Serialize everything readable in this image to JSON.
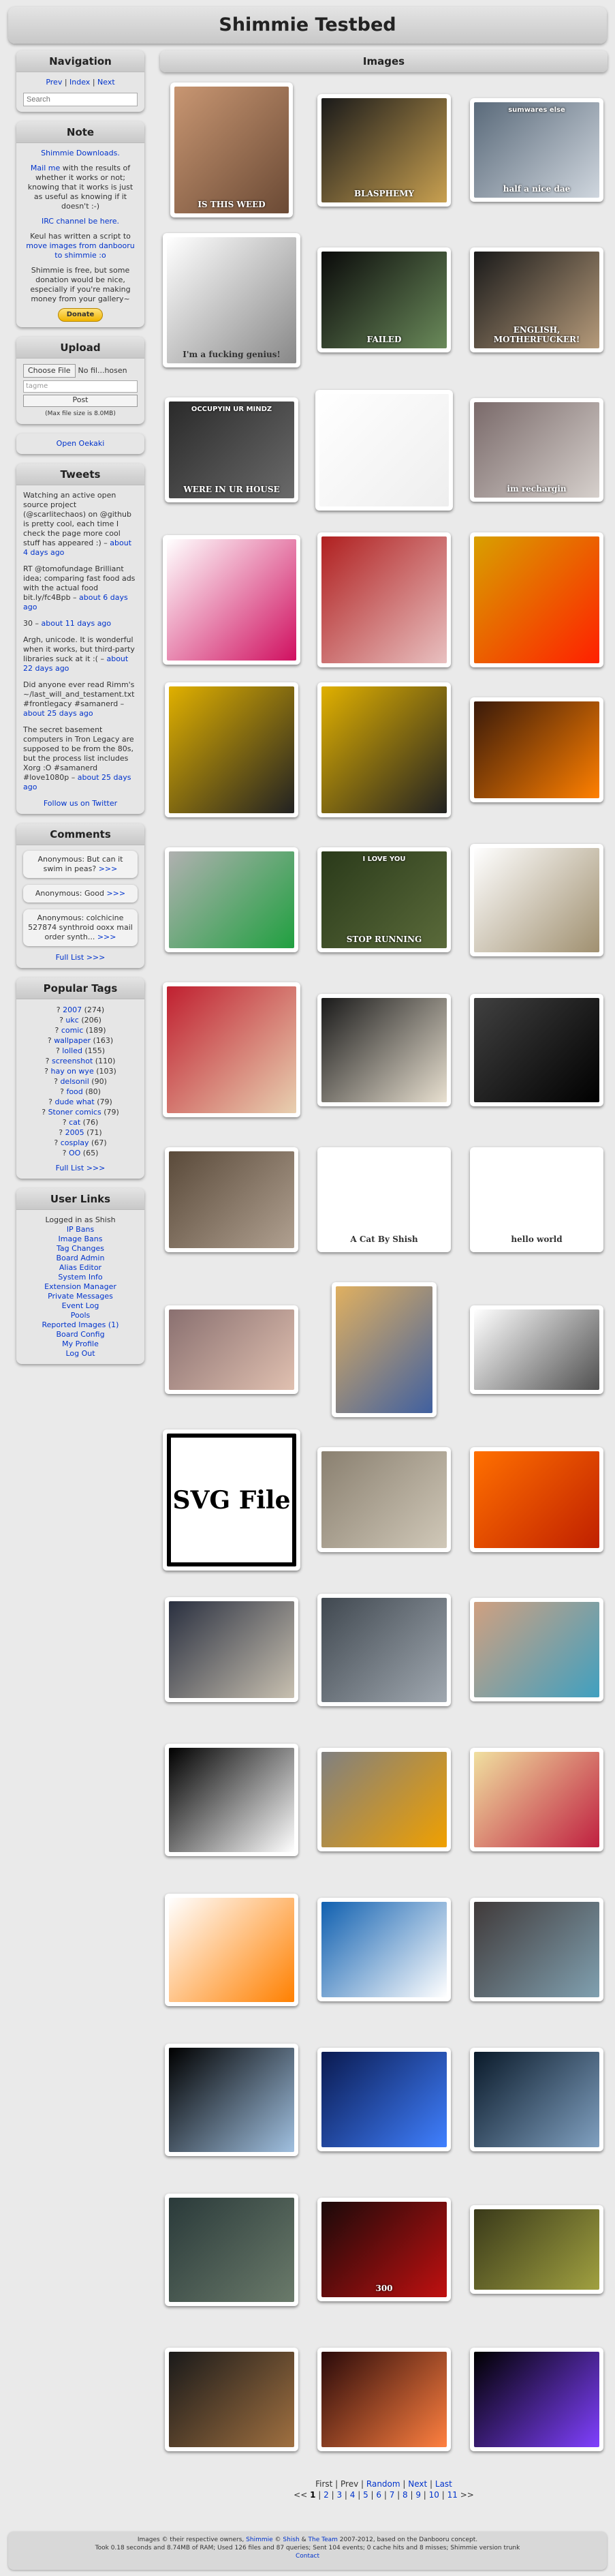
{
  "site_title": "Shimmie Testbed",
  "nav": {
    "title": "Navigation",
    "prev": "Prev",
    "index": "Index",
    "next": "Next",
    "search_placeholder": "Search"
  },
  "note": {
    "title": "Note",
    "link_downloads": "Shimmie Downloads.",
    "mail_link": "Mail me",
    "mail_text": " with the results of whether it works or not; knowing that it works is just as useful as knowing if it doesn't :-)",
    "irc": "IRC channel be here.",
    "keul_text": "Keul has written a script to",
    "keul_link": "move images from danbooru to shimmie :o",
    "free_text": "Shimmie is free, but some donation would be nice, especially if you're making money from your gallery~",
    "donate": "Donate"
  },
  "upload": {
    "title": "Upload",
    "choose": "Choose File",
    "no_file": "No fil...hosen",
    "tags_placeholder": "tagme",
    "post": "Post",
    "max_size": "(Max file size is 8.0MB)"
  },
  "open_oekaki": "Open Oekaki",
  "tweets": {
    "title": "Tweets",
    "items": [
      {
        "text": "Watching an active open source project (@scarlitechaos) on @github is pretty cool, each time I check the page more cool stuff has appeared :) –",
        "time": "about 4 days ago"
      },
      {
        "text": "RT @tomofundage Brilliant idea; comparing fast food ads with the actual food bit.ly/fc4Bpb –",
        "time": "about 6 days ago"
      },
      {
        "text": "30 –",
        "time": "about 11 days ago"
      },
      {
        "text": "Argh, unicode. It is wonderful when it works, but third-party libraries suck at it :( –",
        "time": "about 22 days ago"
      },
      {
        "text": "Did anyone ever read Rimm's ~/last_will_and_testament.txt #frontlegacy #samanerd –",
        "time": "about 25 days ago"
      },
      {
        "text": "The secret basement computers in Tron Legacy are supposed to be from the 80s, but the process list includes Xorg :O #samanerd #love1080p –",
        "time": "about 25 days ago"
      }
    ],
    "follow": "Follow us on Twitter"
  },
  "comments": {
    "title": "Comments",
    "items": [
      {
        "text": "Anonymous: But can it swim in peas?",
        "more": ">>>"
      },
      {
        "text": "Anonymous: Good",
        "more": ">>>"
      },
      {
        "text": "Anonymous: colchicine 527874 synthroid ooxx mail order synth...",
        "more": ">>>"
      }
    ],
    "full_list": "Full List >>>"
  },
  "popular_tags": {
    "title": "Popular Tags",
    "items": [
      {
        "name": "2007",
        "count": "(274)"
      },
      {
        "name": "ukc",
        "count": "(206)"
      },
      {
        "name": "comic",
        "count": "(189)"
      },
      {
        "name": "wallpaper",
        "count": "(163)"
      },
      {
        "name": "lolled",
        "count": "(155)"
      },
      {
        "name": "screenshot",
        "count": "(110)"
      },
      {
        "name": "hay on wye",
        "count": "(103)"
      },
      {
        "name": "delsonil",
        "count": "(90)"
      },
      {
        "name": "food",
        "count": "(80)"
      },
      {
        "name": "dude what",
        "count": "(79)"
      },
      {
        "name": "Stoner comics",
        "count": "(79)"
      },
      {
        "name": "cat",
        "count": "(76)"
      },
      {
        "name": "2005",
        "count": "(71)"
      },
      {
        "name": "cosplay",
        "count": "(67)"
      },
      {
        "name": "OO",
        "count": "(65)"
      }
    ],
    "full_list": "Full List >>>"
  },
  "user_links": {
    "title": "User Links",
    "logged_in": "Logged in as Shish",
    "items": [
      "IP Bans",
      "Image Bans",
      "Tag Changes",
      "Board Admin",
      "Alias Editor",
      "System Info",
      "Extension Manager",
      "Private Messages",
      "Event Log",
      "Pools",
      "Reported Images (1)",
      "Board Config",
      "My Profile",
      "Log Out"
    ]
  },
  "images": {
    "title": "Images",
    "thumbs": [
      {
        "label": "IS THIS WEED",
        "colors": [
          "#c89672",
          "#6b4a35"
        ]
      },
      {
        "label": "BLASPHEMY",
        "colors": [
          "#1a1a1a",
          "#c8a050"
        ]
      },
      {
        "label": "half a nice dae",
        "label2": "sumwares else",
        "colors": [
          "#5a6a7a",
          "#cfd6de"
        ]
      },
      {
        "label": "I'm a fucking genius!",
        "colors": [
          "#ffffff",
          "#888888"
        ]
      },
      {
        "label": "FAILED",
        "colors": [
          "#0a0a0a",
          "#6a8a5a"
        ]
      },
      {
        "label": "ENGLISH, MOTHERFUCKER!",
        "colors": [
          "#1a1a1a",
          "#b59a7a"
        ]
      },
      {
        "label": "WERE IN UR HOUSE",
        "label2": "OCCUPYIN UR MINDZ",
        "colors": [
          "#2a2a2a",
          "#6a6a6a"
        ]
      },
      {
        "label": "",
        "colors": [
          "#ffffff",
          "#eeeeee"
        ]
      },
      {
        "label": "im rechargin",
        "colors": [
          "#7a6a6a",
          "#d6d0cc"
        ]
      },
      {
        "label": "",
        "colors": [
          "#ffffff",
          "#d01060"
        ]
      },
      {
        "label": "",
        "colors": [
          "#b02020",
          "#e8c0c0"
        ]
      },
      {
        "label": "",
        "colors": [
          "#d8a000",
          "#ff2000"
        ]
      },
      {
        "label": "",
        "colors": [
          "#e0b000",
          "#222222"
        ]
      },
      {
        "label": "",
        "colors": [
          "#e0b000",
          "#222222"
        ]
      },
      {
        "label": "",
        "colors": [
          "#3a1a0a",
          "#ff8000"
        ]
      },
      {
        "label": "",
        "colors": [
          "#b0b0b0",
          "#20a040"
        ]
      },
      {
        "label": "STOP RUNNING",
        "label2": "I LOVE YOU",
        "colors": [
          "#2a3a1a",
          "#5a6a3a"
        ]
      },
      {
        "label": "",
        "colors": [
          "#ffffff",
          "#a09070"
        ]
      },
      {
        "label": "",
        "colors": [
          "#c02030",
          "#e8d0b0"
        ]
      },
      {
        "label": "",
        "colors": [
          "#1a1a1a",
          "#e8e0d0"
        ]
      },
      {
        "label": "",
        "colors": [
          "#404040",
          "#000000"
        ]
      },
      {
        "label": "",
        "colors": [
          "#5a4a3a",
          "#b0a090"
        ]
      },
      {
        "label": "A Cat By Shish",
        "colors": [
          "#ffffff",
          "#ffffff"
        ]
      },
      {
        "label": "hello world",
        "colors": [
          "#ffffff",
          "#ffffff"
        ]
      },
      {
        "label": "",
        "colors": [
          "#8a7070",
          "#e0c0b0"
        ]
      },
      {
        "label": "",
        "colors": [
          "#e0b060",
          "#4060a0"
        ]
      },
      {
        "label": "",
        "colors": [
          "#ffffff",
          "#505050"
        ]
      },
      {
        "label": "SVG File",
        "colors": [
          "#ffffff",
          "#000000"
        ]
      },
      {
        "label": "",
        "colors": [
          "#8a8070",
          "#d0c8b8"
        ]
      },
      {
        "label": "",
        "colors": [
          "#ff7000",
          "#c02000"
        ]
      },
      {
        "label": "",
        "colors": [
          "#2a3040",
          "#c8c0b0"
        ]
      },
      {
        "label": "",
        "colors": [
          "#404850",
          "#a0a8b0"
        ]
      },
      {
        "label": "",
        "colors": [
          "#d0a080",
          "#40a0c0"
        ]
      },
      {
        "label": "",
        "colors": [
          "#000000",
          "#ffffff"
        ]
      },
      {
        "label": "",
        "colors": [
          "#808080",
          "#f0a000"
        ]
      },
      {
        "label": "",
        "colors": [
          "#f0e0a0",
          "#c02040"
        ]
      },
      {
        "label": "",
        "colors": [
          "#ffffff",
          "#ff8000"
        ]
      },
      {
        "label": "",
        "colors": [
          "#1060b0",
          "#ffffff"
        ]
      },
      {
        "label": "",
        "colors": [
          "#403a3a",
          "#80a0b0"
        ]
      },
      {
        "label": "",
        "colors": [
          "#000000",
          "#a0c0e0"
        ]
      },
      {
        "label": "",
        "colors": [
          "#0a1a50",
          "#4080ff"
        ]
      },
      {
        "label": "",
        "colors": [
          "#0a1a2a",
          "#80a0c0"
        ]
      },
      {
        "label": "",
        "colors": [
          "#2a3a3a",
          "#6a7a6a"
        ]
      },
      {
        "label": "300",
        "colors": [
          "#1a0a0a",
          "#c01010"
        ]
      },
      {
        "label": "",
        "colors": [
          "#3a3a1a",
          "#a0a040"
        ]
      },
      {
        "label": "",
        "colors": [
          "#1a1a1a",
          "#a07040"
        ]
      },
      {
        "label": "",
        "colors": [
          "#2a0a0a",
          "#ff8040"
        ]
      },
      {
        "label": "",
        "colors": [
          "#000000",
          "#8040ff"
        ]
      }
    ]
  },
  "paginator": {
    "line1": [
      "First",
      "Prev",
      "Random",
      "Next",
      "Last"
    ],
    "prefix": "<<",
    "pages": [
      "1",
      "2",
      "3",
      "4",
      "5",
      "6",
      "7",
      "8",
      "9",
      "10",
      "11"
    ],
    "suffix": ">>"
  },
  "footer": {
    "line1_a": "Images © their respective owners,",
    "line1_shimmie": "Shimmie",
    "line1_b": "©",
    "line1_shish": "Shish",
    "line1_c": "&",
    "line1_team": "The Team",
    "line1_d": "2007-2012, based on the Danbooru concept.",
    "line2": "Took 0.18 seconds and 8.74MB of RAM; Used 126 files and 87 queries; Sent 104 events; 0 cache hits and 8 misses; Shimmie version trunk",
    "contact": "Contact"
  }
}
